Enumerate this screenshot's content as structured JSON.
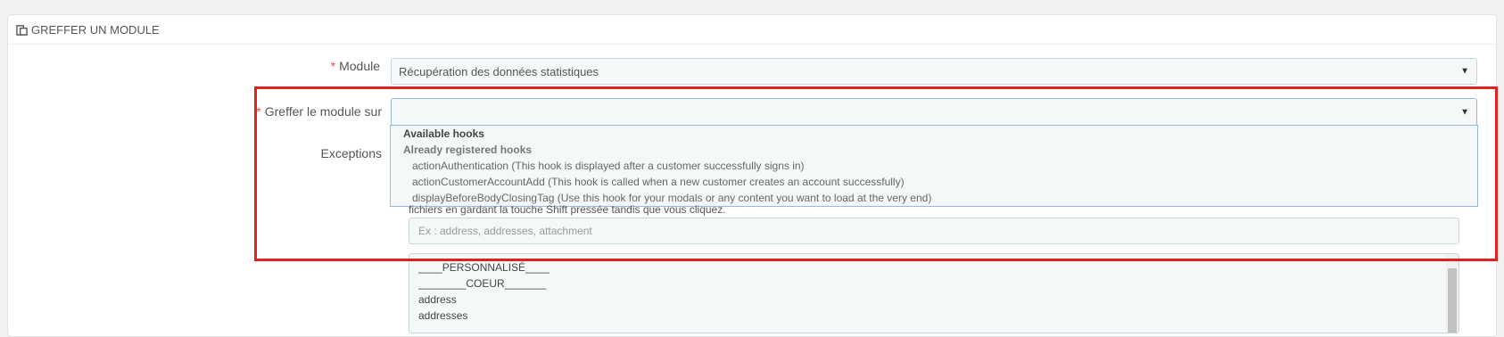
{
  "panel": {
    "title": "GREFFER UN MODULE",
    "icon": "paste-icon"
  },
  "form": {
    "module_label": "Module",
    "module_value": "Récupération des données statistiques",
    "hook_label": "Greffer le module sur",
    "hook_value": "",
    "exceptions_label": "Exceptions"
  },
  "dropdown": {
    "group_available": "Available hooks",
    "group_registered": "Already registered hooks",
    "options": [
      "actionAuthentication (This hook is displayed after a customer successfully signs in)",
      "actionCustomerAccountAdd (This hook is called when a new customer creates an account successfully)",
      "displayBeforeBodyClosingTag (Use this hook for your modals or any content you want to load at the very end)"
    ]
  },
  "exceptions": {
    "hint": "fichiers en gardant la touche Shift pressée tandis que vous cliquez.",
    "placeholder": "Ex : address, addresses, attachment",
    "list": [
      "____PERSONNALISÉ____",
      "________COEUR_______",
      "address",
      "addresses"
    ]
  },
  "colors": {
    "required": "#e84e40",
    "highlight": "#e32020",
    "focus_border": "#96b9e0"
  }
}
